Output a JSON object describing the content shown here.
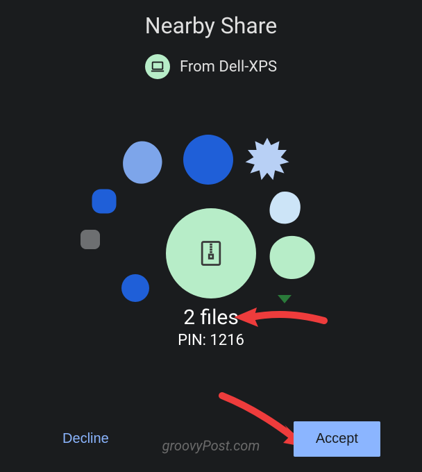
{
  "title": "Nearby Share",
  "from_label": "From Dell-XPS",
  "files_label": "2 files",
  "pin_label": "PIN: 1216",
  "buttons": {
    "decline": "Decline",
    "accept": "Accept"
  },
  "watermark": "groovyPost.com",
  "colors": {
    "background": "#1a1c1e",
    "accent_green": "#b7edc8",
    "accent_blue": "#8bb5ff",
    "dark_blue": "#1f5fd8",
    "mid_blue": "#7da5ea",
    "light_blue": "#cce4f7",
    "gray": "#6d6f71",
    "arrow_red": "#ee3c3c"
  }
}
